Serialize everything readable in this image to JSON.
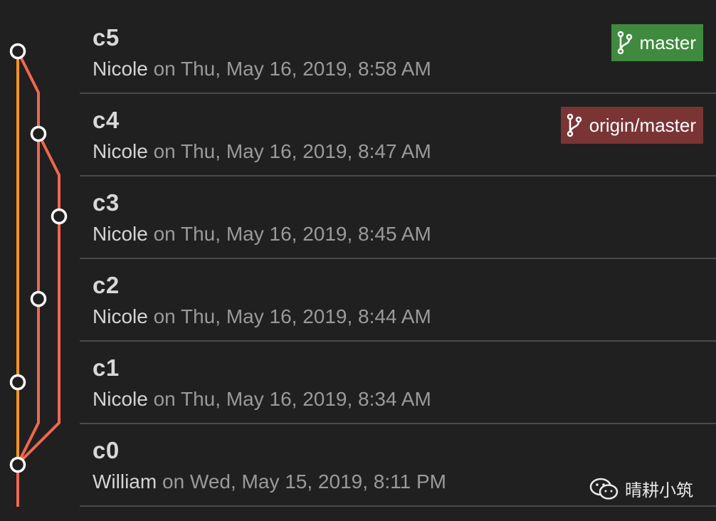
{
  "commits": [
    {
      "title": "c5",
      "author": "Nicole",
      "date": " on Thu, May 16, 2019, 8:58 AM",
      "branch": {
        "label": "master",
        "type": "local"
      }
    },
    {
      "title": "c4",
      "author": "Nicole",
      "date": " on Thu, May 16, 2019, 8:47 AM",
      "branch": {
        "label": "origin/master",
        "type": "remote"
      }
    },
    {
      "title": "c3",
      "author": "Nicole",
      "date": " on Thu, May 16, 2019, 8:45 AM"
    },
    {
      "title": "c2",
      "author": "Nicole",
      "date": " on Thu, May 16, 2019, 8:44 AM"
    },
    {
      "title": "c1",
      "author": "Nicole",
      "date": " on Thu, May 16, 2019, 8:34 AM"
    },
    {
      "title": "c0",
      "author": "William",
      "date": " on Wed, May 15, 2019, 8:11 PM"
    }
  ],
  "colors": {
    "main_line": "#f5931f",
    "branch_line": "#f0674f",
    "local_badge": "#3f8a3f",
    "remote_badge": "#7a3434",
    "node_fill": "#202020",
    "node_stroke": "#ffffff"
  },
  "icons": {
    "branch": "git-branch-icon",
    "watermark": "wechat-icon"
  },
  "watermark": {
    "text": "晴耕小筑"
  }
}
